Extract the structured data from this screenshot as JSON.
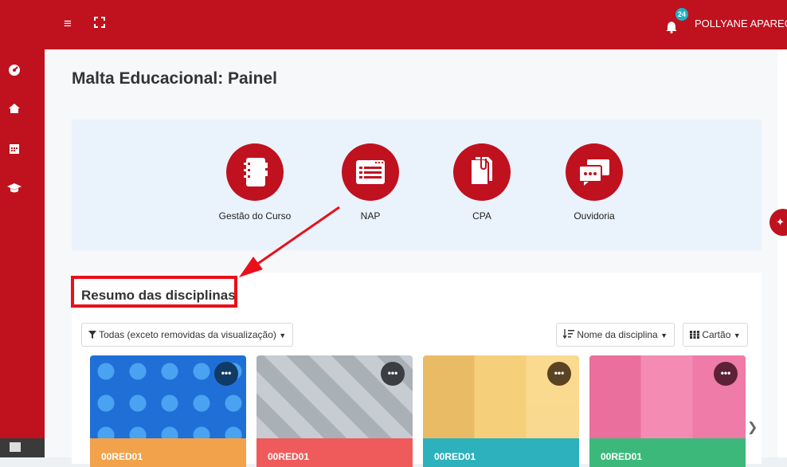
{
  "header": {
    "hamburger_glyph": "≡",
    "notifications": {
      "count": "24"
    },
    "user_name": "POLLYANE APAREC"
  },
  "page": {
    "title": "Malta Educacional: Painel"
  },
  "quick_links": [
    {
      "label": "Gestão do Curso",
      "icon": "notebook-icon"
    },
    {
      "label": "NAP",
      "icon": "list-document-icon"
    },
    {
      "label": "CPA",
      "icon": "clipped-papers-icon"
    },
    {
      "label": "Ouvidoria",
      "icon": "chat-bubbles-icon"
    }
  ],
  "course_summary": {
    "title": "Resumo das disciplinas",
    "filter_label": "Todas (exceto removidas da visualização)",
    "sort_label": "Nome da disciplina",
    "view_label": "Cartão",
    "courses": [
      {
        "code": "00RED01",
        "band_color": "#f1a24a",
        "image_color": "#1f6fd6"
      },
      {
        "code": "00RED01",
        "band_color": "#ef5b5b",
        "image_color": "#b8bec4"
      },
      {
        "code": "00RED01",
        "band_color": "#2cb1bd",
        "image_color": "#f4c56a"
      },
      {
        "code": "00RED01",
        "band_color": "#3cb97a",
        "image_color": "#f07aa6"
      }
    ],
    "more_glyph": "•••"
  },
  "colors": {
    "brand": "#c0111f",
    "annotation": "#e8101b"
  }
}
